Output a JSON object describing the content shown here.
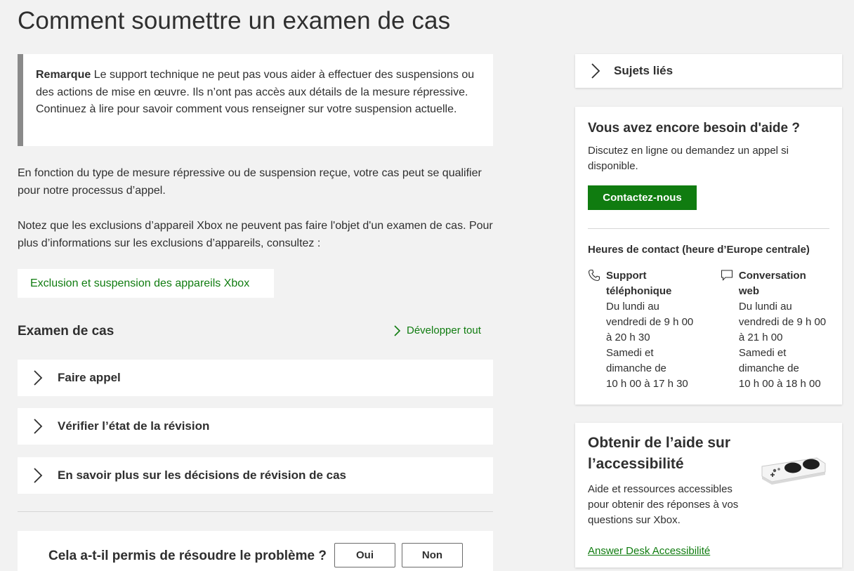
{
  "page": {
    "title": "Comment soumettre un examen de cas"
  },
  "note": {
    "label": "Remarque",
    "text": " Le support technique ne peut pas vous aider à effectuer des suspensions ou des actions de mise en œuvre. Ils n’ont pas accès aux détails de la mesure répressive. Continuez à lire pour savoir comment vous renseigner sur votre suspension actuelle."
  },
  "paragraphs": {
    "p1": "En fonction du type de mesure répressive ou de suspension reçue, votre cas peut se qualifier pour notre processus d’appel.",
    "p2": "Notez que les exclusions d’appareil Xbox ne peuvent pas faire l'objet d'un examen de cas. Pour plus d’informations sur les exclusions d’appareils, consultez :"
  },
  "link_card": {
    "label": "Exclusion et suspension des appareils Xbox"
  },
  "case_review": {
    "title": "Examen de cas",
    "expand_all": "Développer tout",
    "items": [
      {
        "label": "Faire appel"
      },
      {
        "label": "Vérifier l’état de la révision"
      },
      {
        "label": "En savoir plus sur les décisions de révision de cas"
      }
    ]
  },
  "feedback": {
    "question": "Cela a-t-il permis de résoudre le problème ?",
    "yes": "Oui",
    "no": "Non"
  },
  "sidebar": {
    "related_topics": "Sujets liés",
    "help": {
      "title": "Vous avez encore besoin d'aide ?",
      "description": "Discutez en ligne ou demandez un appel si disponible.",
      "contact_button": "Contactez-nous",
      "hours_title": "Heures de contact (heure d’Europe centrale)",
      "phone": {
        "title_line1": "Support",
        "title_line2": "téléphonique",
        "lines": [
          "Du lundi au",
          "vendredi de 9 h 00",
          "à 20 h 30",
          "Samedi et",
          "dimanche de",
          "10 h 00 à 17 h 30"
        ]
      },
      "chat": {
        "title": "Conversation web",
        "lines": [
          "Du lundi au",
          "vendredi de 9 h 00",
          "à 21 h 00",
          "Samedi et",
          "dimanche de",
          "10 h 00 à 18 h 00"
        ]
      }
    },
    "accessibility": {
      "title": "Obtenir de l’aide sur l’accessibilité",
      "description": "Aide et ressources accessibles pour obtenir des réponses à vos questions sur Xbox.",
      "link": "Answer Desk Accessibilité"
    }
  },
  "colors": {
    "accent_green": "#107c10",
    "background": "#f2f2f2",
    "note_border": "#8a8a8a"
  }
}
